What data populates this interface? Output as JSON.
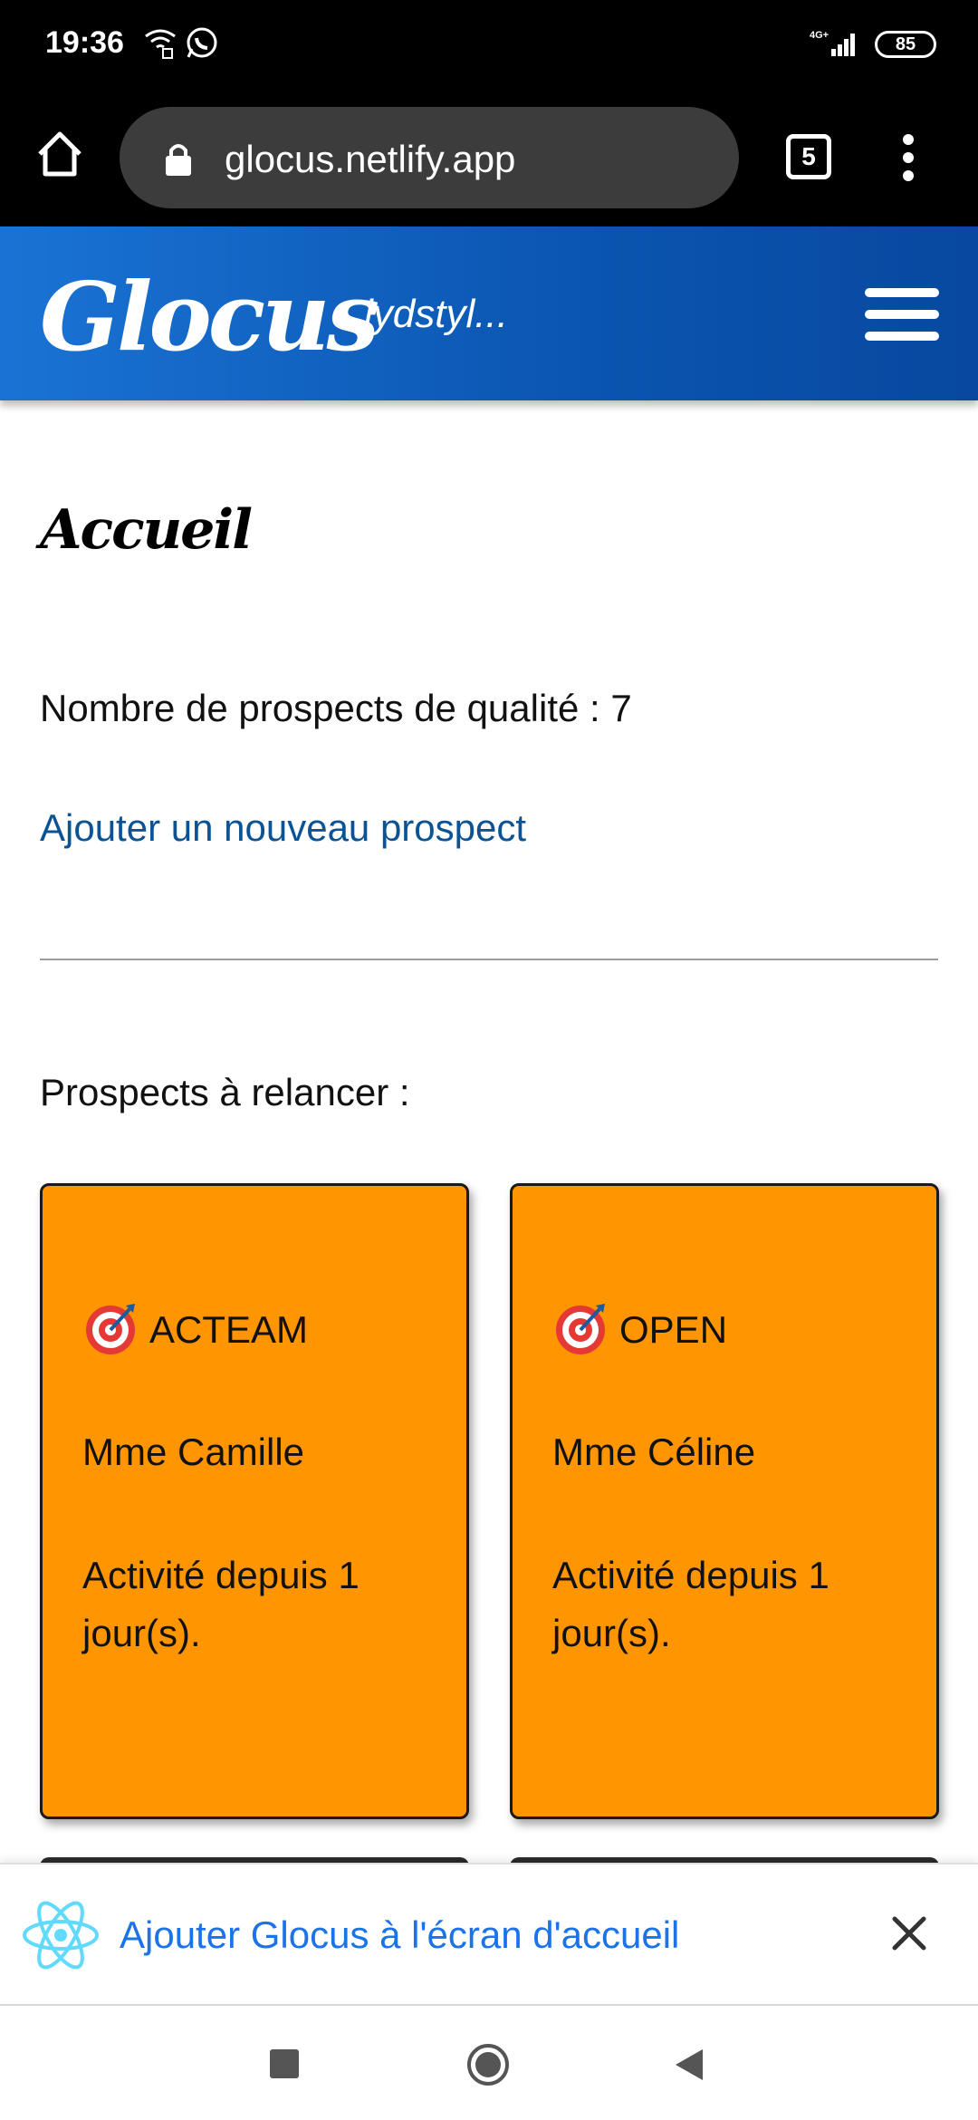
{
  "status_bar": {
    "time": "19:36",
    "network": "4G+",
    "battery": "85"
  },
  "browser": {
    "url": "glocus.netlify.app",
    "tab_count": "5"
  },
  "header": {
    "logo": "Glocus",
    "user": "lydstyl..."
  },
  "main": {
    "title": "Accueil",
    "quality_prospects": "Nombre de prospects de qualité : 7",
    "add_prospect_link": "Ajouter un nouveau prospect",
    "relance_title": "Prospects à relancer :",
    "cards": [
      {
        "company": "ACTEAM",
        "contact": "Mme Camille",
        "activity": "Activité depuis 1 jour(s)."
      },
      {
        "company": "OPEN",
        "contact": "Mme Céline",
        "activity": "Activité depuis 1 jour(s)."
      }
    ],
    "card_color": "#ff9500"
  },
  "install_banner": {
    "text": "Ajouter Glocus à l'écran d'accueil"
  },
  "colors": {
    "header_blue": "#0a55b0",
    "link_blue": "#0b5394",
    "banner_link": "#1a73e8"
  }
}
